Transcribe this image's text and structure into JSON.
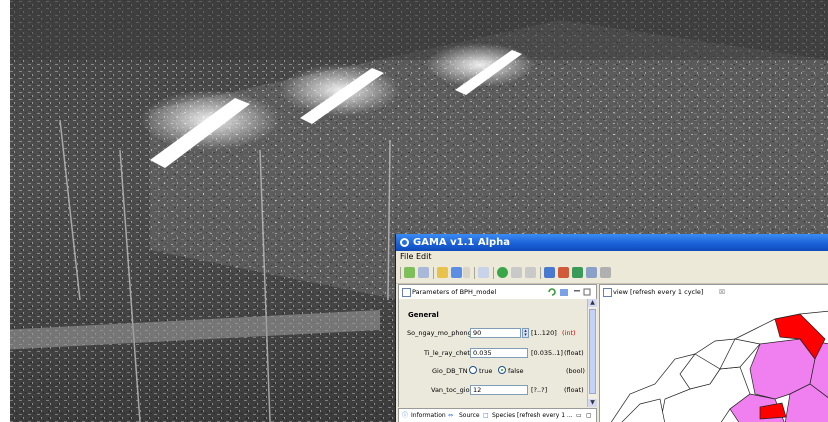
{
  "window": {
    "title": "GAMA v1.1 Alpha",
    "menu": [
      "File",
      "Edit"
    ]
  },
  "params_tab": {
    "label": "Parameters of BPH_model"
  },
  "view_tab": {
    "label": "view [refresh every 1 cycle]",
    "close_glyph": "☒"
  },
  "section": {
    "title": "General"
  },
  "parameters": [
    {
      "label": "So_ngay_mo_phong",
      "value": "90",
      "range": "[1..120]",
      "type": "(int)",
      "type_color": "#cc0000"
    },
    {
      "label": "Ti_le_ray_chet",
      "value": "0.035",
      "range": "[0.035..1]",
      "type": "(float)"
    },
    {
      "label": "Gio_DB_TN",
      "option_true": "true",
      "option_false": "false",
      "selected": "false",
      "type": "(bool)"
    },
    {
      "label": "Van_toc_gio",
      "value": "12",
      "range": "[?..?]",
      "type": "(float)"
    }
  ],
  "bottom_tabs": [
    "Information",
    "Source",
    "Species [refresh every 1 ..."
  ],
  "colors": {
    "title_blue": "#1a5fd6",
    "region_red": "#ff0000",
    "region_pink": "#f080f0",
    "int_red": "#cc0000"
  },
  "icons": [
    "gama-app-icon",
    "new-icon",
    "open-icon",
    "edit-icon",
    "run-icon",
    "step-icon",
    "pause-icon",
    "stop-icon",
    "species-icon",
    "agents-icon",
    "table-icon",
    "grid-icon",
    "export-icon"
  ]
}
